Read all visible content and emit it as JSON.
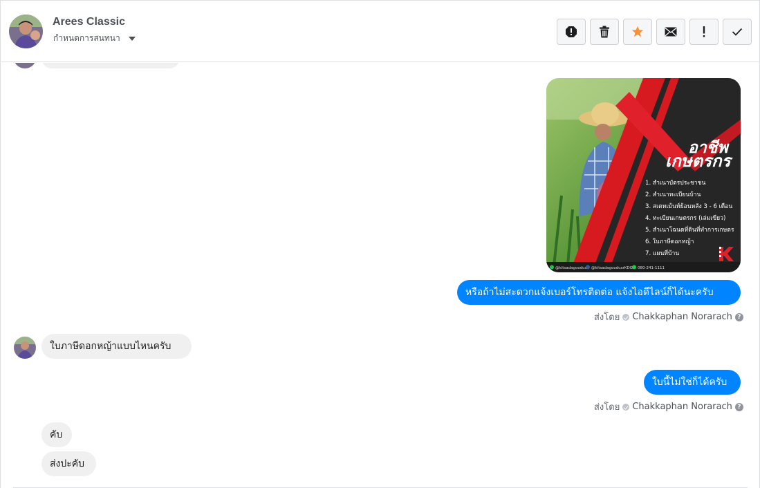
{
  "header": {
    "contact_name": "Arees Classic",
    "assign_label": "กำหนดการสนทนา",
    "toolbar": [
      {
        "icon": "alert-icon",
        "name": "mark-spam-button"
      },
      {
        "icon": "trash-icon",
        "name": "delete-button"
      },
      {
        "icon": "star-icon",
        "name": "star-button"
      },
      {
        "icon": "envelope-icon",
        "name": "mark-unread-button"
      },
      {
        "icon": "exclamation-icon",
        "name": "follow-up-button"
      },
      {
        "icon": "check-icon",
        "name": "mark-done-button"
      }
    ]
  },
  "image_card": {
    "title_line1": "อาชีพ",
    "title_line2": "เกษตรกร",
    "items": [
      "1. สำเนาบัตรประชาชน",
      "2. สำเนาทะเบียนบ้าน",
      "3. สเตทเม้นท์ย้อนหลัง 3 - 6 เดือน",
      "4. ทะเบียนเกษตรกร (เล่มเขียว)",
      "5. สำเนาโฉนดที่ดินที่ทำการเกษตร",
      "6. ใบภาษีดอกหญ้า",
      "7. แผนที่บ้าน"
    ],
    "footer": [
      "@kitsadagoodcar",
      "@kitsadagoodcarKDG",
      "080-241-1111"
    ],
    "brand": "KITSADAGOODCAR"
  },
  "messages": {
    "out1": "หรือถ้าไม่สะดวกแจ้งเบอร์โทรติดต่อ แจ้งไอดีไลน์ก็ได้นะครับ",
    "sent_by_label1": "ส่งโดย",
    "agent1": "Chakkaphan Norarach",
    "in1": "ใบภาษีดอกหญ้าแบบไหนครับ",
    "out2": "ใบนี้ไม่ใช่ก็ได้ครับ",
    "sent_by_label2": "ส่งโดย",
    "agent2": "Chakkaphan Norarach",
    "in2": "คับ",
    "in3": "ส่งปะคับ"
  },
  "colors": {
    "accent_blue": "#0084ff",
    "star_orange": "#f7923b",
    "incoming_bubble": "#f1f0f0"
  }
}
